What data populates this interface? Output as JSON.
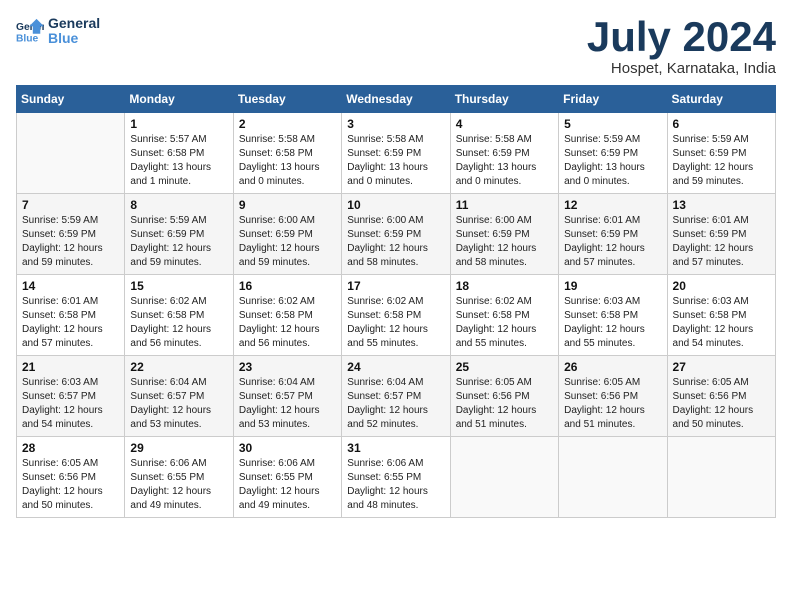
{
  "header": {
    "logo_line1": "General",
    "logo_line2": "Blue",
    "month_title": "July 2024",
    "subtitle": "Hospet, Karnataka, India"
  },
  "columns": [
    "Sunday",
    "Monday",
    "Tuesday",
    "Wednesday",
    "Thursday",
    "Friday",
    "Saturday"
  ],
  "weeks": [
    [
      {
        "day": "",
        "info": ""
      },
      {
        "day": "1",
        "info": "Sunrise: 5:57 AM\nSunset: 6:58 PM\nDaylight: 13 hours\nand 1 minute."
      },
      {
        "day": "2",
        "info": "Sunrise: 5:58 AM\nSunset: 6:58 PM\nDaylight: 13 hours\nand 0 minutes."
      },
      {
        "day": "3",
        "info": "Sunrise: 5:58 AM\nSunset: 6:59 PM\nDaylight: 13 hours\nand 0 minutes."
      },
      {
        "day": "4",
        "info": "Sunrise: 5:58 AM\nSunset: 6:59 PM\nDaylight: 13 hours\nand 0 minutes."
      },
      {
        "day": "5",
        "info": "Sunrise: 5:59 AM\nSunset: 6:59 PM\nDaylight: 13 hours\nand 0 minutes."
      },
      {
        "day": "6",
        "info": "Sunrise: 5:59 AM\nSunset: 6:59 PM\nDaylight: 12 hours\nand 59 minutes."
      }
    ],
    [
      {
        "day": "7",
        "info": "Sunrise: 5:59 AM\nSunset: 6:59 PM\nDaylight: 12 hours\nand 59 minutes."
      },
      {
        "day": "8",
        "info": "Sunrise: 5:59 AM\nSunset: 6:59 PM\nDaylight: 12 hours\nand 59 minutes."
      },
      {
        "day": "9",
        "info": "Sunrise: 6:00 AM\nSunset: 6:59 PM\nDaylight: 12 hours\nand 59 minutes."
      },
      {
        "day": "10",
        "info": "Sunrise: 6:00 AM\nSunset: 6:59 PM\nDaylight: 12 hours\nand 58 minutes."
      },
      {
        "day": "11",
        "info": "Sunrise: 6:00 AM\nSunset: 6:59 PM\nDaylight: 12 hours\nand 58 minutes."
      },
      {
        "day": "12",
        "info": "Sunrise: 6:01 AM\nSunset: 6:59 PM\nDaylight: 12 hours\nand 57 minutes."
      },
      {
        "day": "13",
        "info": "Sunrise: 6:01 AM\nSunset: 6:59 PM\nDaylight: 12 hours\nand 57 minutes."
      }
    ],
    [
      {
        "day": "14",
        "info": "Sunrise: 6:01 AM\nSunset: 6:58 PM\nDaylight: 12 hours\nand 57 minutes."
      },
      {
        "day": "15",
        "info": "Sunrise: 6:02 AM\nSunset: 6:58 PM\nDaylight: 12 hours\nand 56 minutes."
      },
      {
        "day": "16",
        "info": "Sunrise: 6:02 AM\nSunset: 6:58 PM\nDaylight: 12 hours\nand 56 minutes."
      },
      {
        "day": "17",
        "info": "Sunrise: 6:02 AM\nSunset: 6:58 PM\nDaylight: 12 hours\nand 55 minutes."
      },
      {
        "day": "18",
        "info": "Sunrise: 6:02 AM\nSunset: 6:58 PM\nDaylight: 12 hours\nand 55 minutes."
      },
      {
        "day": "19",
        "info": "Sunrise: 6:03 AM\nSunset: 6:58 PM\nDaylight: 12 hours\nand 55 minutes."
      },
      {
        "day": "20",
        "info": "Sunrise: 6:03 AM\nSunset: 6:58 PM\nDaylight: 12 hours\nand 54 minutes."
      }
    ],
    [
      {
        "day": "21",
        "info": "Sunrise: 6:03 AM\nSunset: 6:57 PM\nDaylight: 12 hours\nand 54 minutes."
      },
      {
        "day": "22",
        "info": "Sunrise: 6:04 AM\nSunset: 6:57 PM\nDaylight: 12 hours\nand 53 minutes."
      },
      {
        "day": "23",
        "info": "Sunrise: 6:04 AM\nSunset: 6:57 PM\nDaylight: 12 hours\nand 53 minutes."
      },
      {
        "day": "24",
        "info": "Sunrise: 6:04 AM\nSunset: 6:57 PM\nDaylight: 12 hours\nand 52 minutes."
      },
      {
        "day": "25",
        "info": "Sunrise: 6:05 AM\nSunset: 6:56 PM\nDaylight: 12 hours\nand 51 minutes."
      },
      {
        "day": "26",
        "info": "Sunrise: 6:05 AM\nSunset: 6:56 PM\nDaylight: 12 hours\nand 51 minutes."
      },
      {
        "day": "27",
        "info": "Sunrise: 6:05 AM\nSunset: 6:56 PM\nDaylight: 12 hours\nand 50 minutes."
      }
    ],
    [
      {
        "day": "28",
        "info": "Sunrise: 6:05 AM\nSunset: 6:56 PM\nDaylight: 12 hours\nand 50 minutes."
      },
      {
        "day": "29",
        "info": "Sunrise: 6:06 AM\nSunset: 6:55 PM\nDaylight: 12 hours\nand 49 minutes."
      },
      {
        "day": "30",
        "info": "Sunrise: 6:06 AM\nSunset: 6:55 PM\nDaylight: 12 hours\nand 49 minutes."
      },
      {
        "day": "31",
        "info": "Sunrise: 6:06 AM\nSunset: 6:55 PM\nDaylight: 12 hours\nand 48 minutes."
      },
      {
        "day": "",
        "info": ""
      },
      {
        "day": "",
        "info": ""
      },
      {
        "day": "",
        "info": ""
      }
    ]
  ]
}
